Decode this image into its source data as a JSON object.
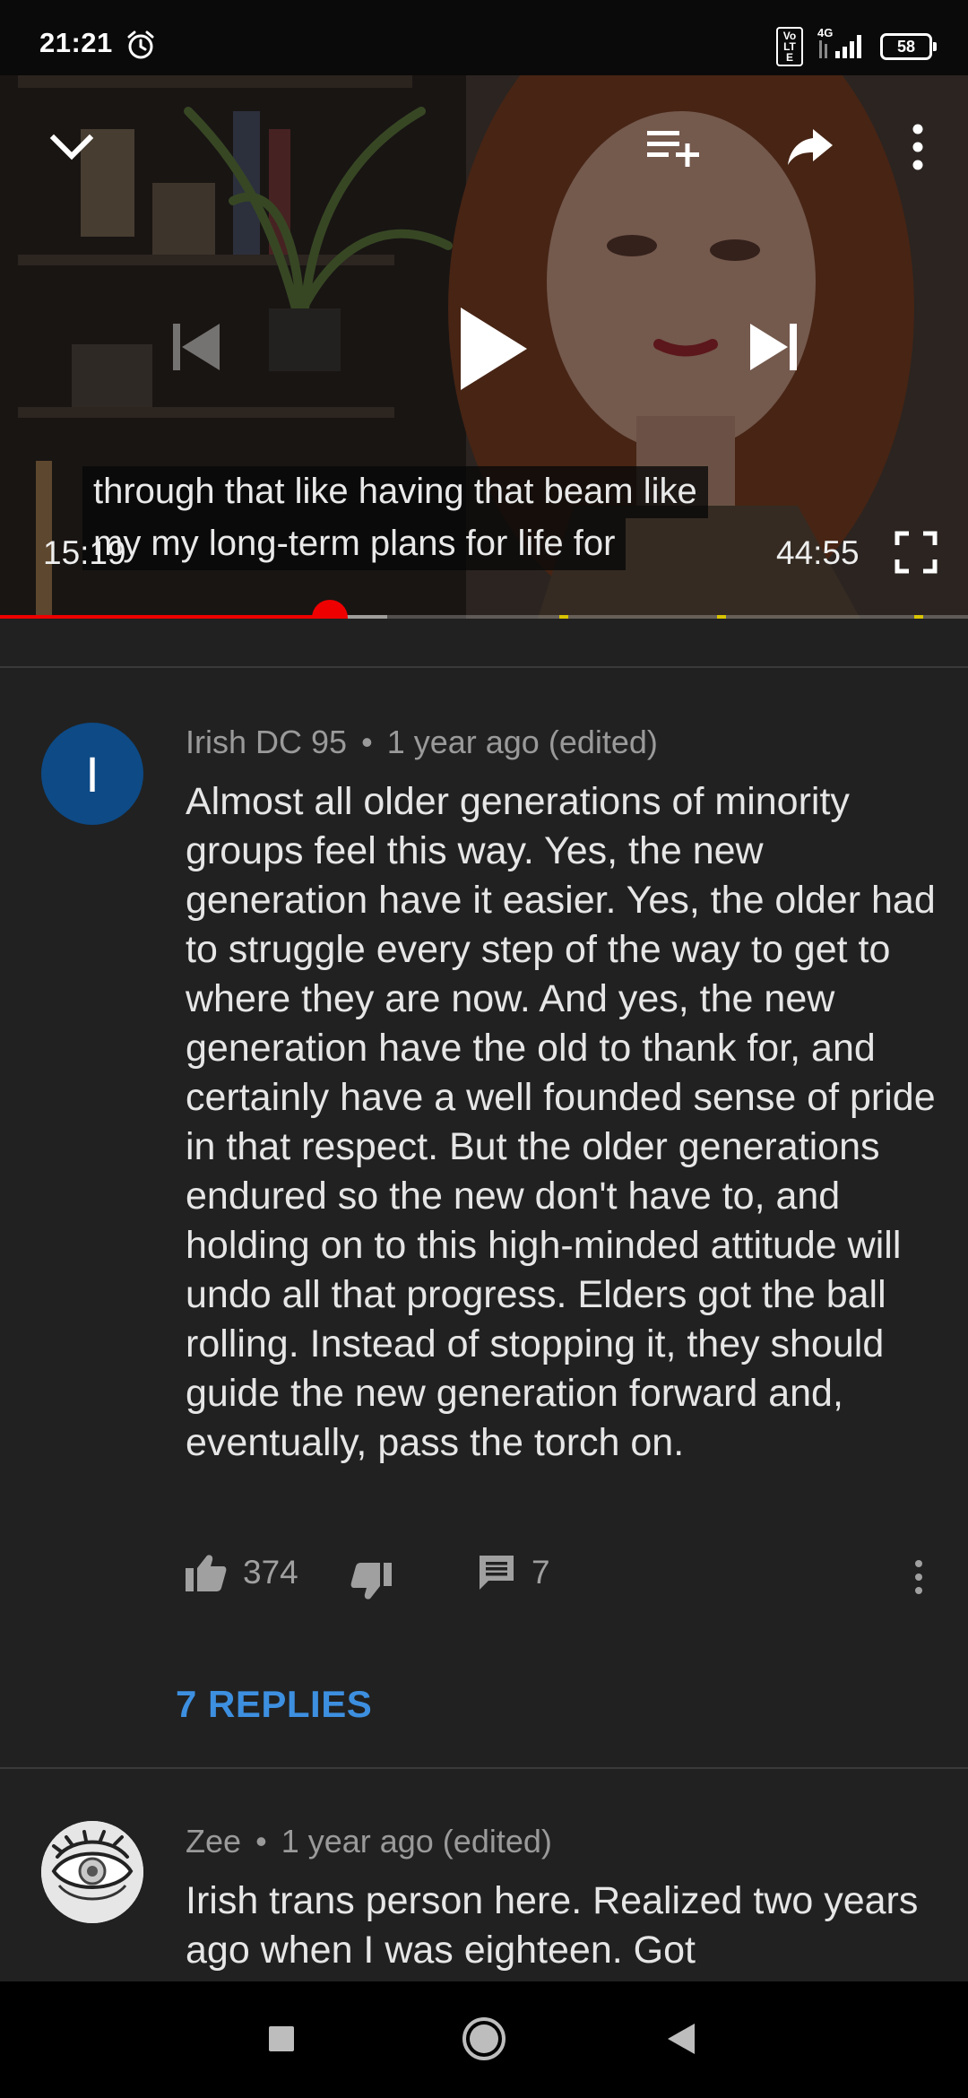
{
  "status_bar": {
    "time": "21:21",
    "network_badge": "Vo LTE",
    "network_type": "4G",
    "battery": "58"
  },
  "player": {
    "caption_line1": "through that like having that beam like",
    "caption_line2": "my my long-term plans for life for",
    "current_time": "15:19",
    "total_time": "44:55",
    "progress_fraction": 0.341,
    "buffer_fraction": 0.4,
    "colors": {
      "progress": "#ee0000",
      "ad_marker": "#d8c400"
    },
    "icons": [
      "chevron-down-icon",
      "add-to-queue-icon",
      "share-icon",
      "more-vertical-icon",
      "skip-previous-icon",
      "play-icon",
      "skip-next-icon",
      "fullscreen-icon"
    ]
  },
  "comments": [
    {
      "author": "Irish DC 95",
      "age": "1 year ago (edited)",
      "avatar_letter": "I",
      "avatar_color": "#0d4a86",
      "text": "Almost all older generations of minority groups feel this way.  Yes, the new generation have it easier.  Yes, the older had to struggle every step of the way to get to where they are now.  And yes, the new generation have the old to thank for, and certainly have a well founded sense of pride in that respect.  But the older generations endured so the new don't have to, and holding on to this high-minded attitude will undo all that progress.  Elders got the ball rolling.  Instead of stopping it, they should guide the new generation forward and, eventually, pass the torch on.",
      "likes": "374",
      "reply_count": "7",
      "replies_label": "7 REPLIES"
    },
    {
      "author": "Zee",
      "age": "1 year ago (edited)",
      "text": "Irish trans person here. Realized two years ago when I was eighteen. Got"
    }
  ],
  "meta_separator": "•",
  "accent_color": "#3d8fe0"
}
